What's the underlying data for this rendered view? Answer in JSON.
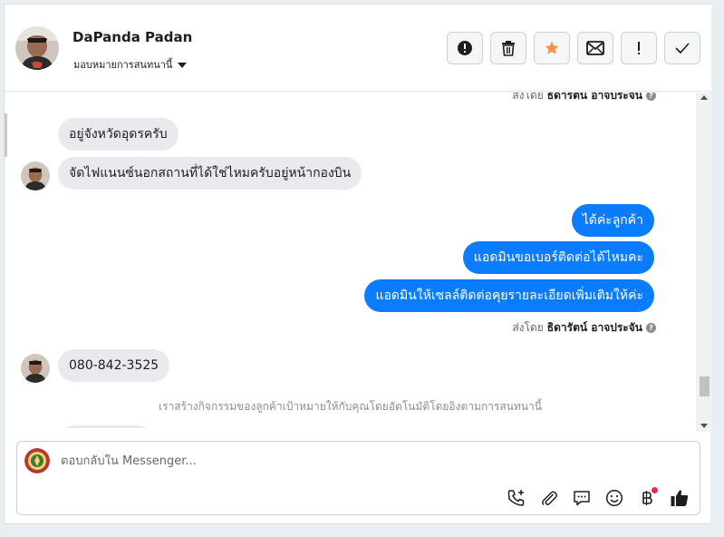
{
  "header": {
    "contact_name": "DaPanda Padan",
    "assign_label": "มอบหมายการสนทนานี้",
    "actions": [
      {
        "name": "mark-spam-button",
        "icon": "alert-circle-icon"
      },
      {
        "name": "delete-button",
        "icon": "trash-icon"
      },
      {
        "name": "star-button",
        "icon": "star-icon"
      },
      {
        "name": "mark-unread-button",
        "icon": "envelope-icon"
      },
      {
        "name": "follow-up-button",
        "icon": "exclamation-icon"
      },
      {
        "name": "mark-done-button",
        "icon": "check-icon"
      }
    ]
  },
  "chat": {
    "sent_by_prefix": "ส่งโดย",
    "top_sent_by_name": "ธิดารัตน์ อาจประจัน",
    "incoming_1": "อยู่จังหวัดอุดรครับ",
    "incoming_2": "จัดไฟแนนซ์นอกสถานที่ได้ใช่ไหมครับอยู่หน้ากองบิน",
    "outgoing_1": "ได้ค่ะลูกค้า",
    "outgoing_2": "แอดมินขอเบอร์ติดต่อได้ไหมคะ",
    "outgoing_3": "แอดมินให้เซลล์ติดต่อคุยรายละเอียดเพิ่มเติมให้ค่ะ",
    "sent_by_name": "ธิดารัตน์ อาจประจัน",
    "incoming_3": "080-842-3525",
    "system_message": "เราสร้างกิจกรรมของลูกค้าเป้าหมายให้กับคุณโดยอัตโนมัติโดยอิงตามการสนทนานี้"
  },
  "composer": {
    "placeholder": "ตอบกลับใน Messenger...",
    "tools": [
      "phone-plus-icon",
      "paperclip-icon",
      "chat-bubble-icon",
      "smiley-icon",
      "baht-icon",
      "thumbs-up-icon"
    ]
  },
  "colors": {
    "accent": "#0a7cff",
    "star": "#f7923b",
    "notification": "#f02849"
  }
}
